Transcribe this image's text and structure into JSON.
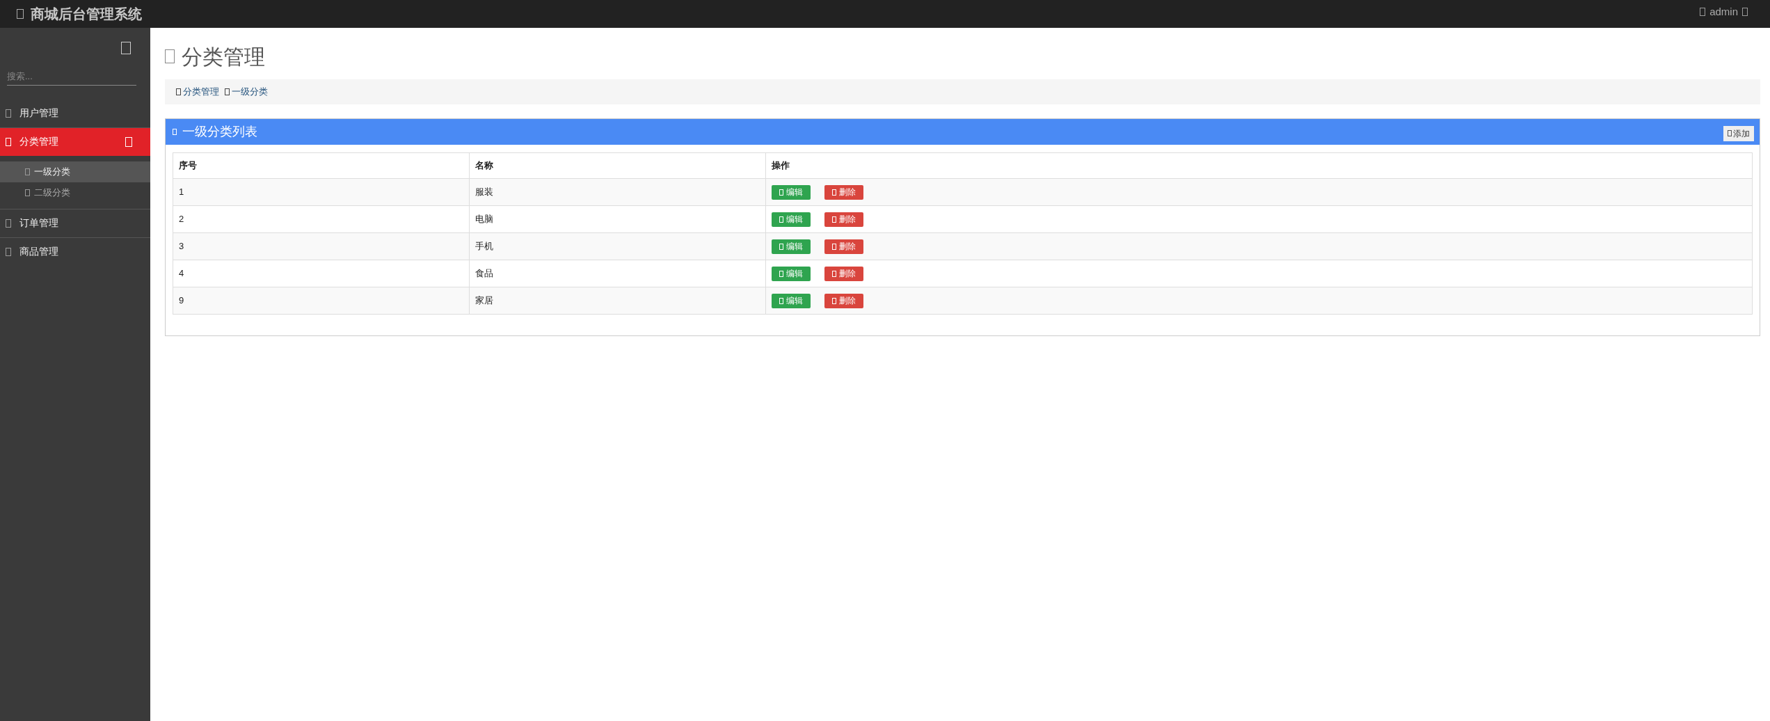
{
  "header": {
    "title": "商城后台管理系统",
    "user": "admin"
  },
  "sidebar": {
    "search": {
      "placeholder": "搜索..."
    },
    "items": [
      {
        "label": "用户管理",
        "selected": false,
        "expanded": false
      },
      {
        "label": "分类管理",
        "selected": true,
        "expanded": true,
        "children": [
          {
            "label": "一级分类",
            "selected": true
          },
          {
            "label": "二级分类",
            "selected": false
          }
        ]
      },
      {
        "label": "订单管理",
        "selected": false,
        "expanded": false
      },
      {
        "label": "商品管理",
        "selected": false,
        "expanded": false
      }
    ]
  },
  "page_title": "分类管理",
  "breadcrumb": [
    {
      "label": "分类管理"
    },
    {
      "label": "一级分类"
    }
  ],
  "panel": {
    "title": "一级分类列表",
    "add_button": "添加",
    "table": {
      "columns": [
        "序号",
        "名称",
        "操作"
      ],
      "rows": [
        {
          "id": "1",
          "name": "服装",
          "actions": [
            "编辑",
            "删除"
          ]
        },
        {
          "id": "2",
          "name": "电脑",
          "actions": [
            "编辑",
            "删除"
          ]
        },
        {
          "id": "3",
          "name": "手机",
          "actions": [
            "编辑",
            "删除"
          ]
        },
        {
          "id": "4",
          "name": "食品",
          "actions": [
            "编辑",
            "删除"
          ]
        },
        {
          "id": "9",
          "name": "家居",
          "actions": [
            "编辑",
            "删除"
          ]
        }
      ]
    }
  }
}
